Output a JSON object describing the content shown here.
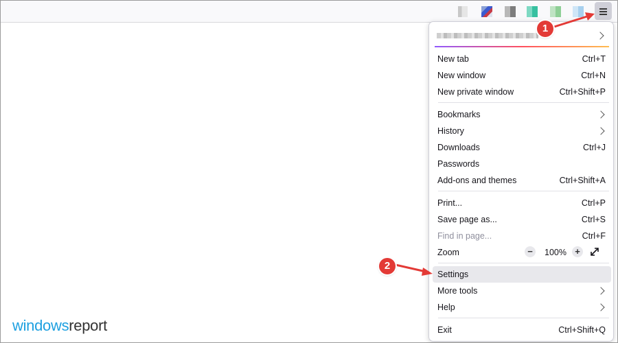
{
  "extensions": [
    {
      "icon": "extension-icon-1"
    },
    {
      "icon": "extension-icon-2"
    },
    {
      "icon": "extension-icon-3"
    },
    {
      "icon": "extension-icon-4"
    },
    {
      "icon": "extension-icon-5"
    },
    {
      "icon": "extension-icon-6"
    }
  ],
  "menu_button": {
    "icon": "hamburger-menu-icon"
  },
  "menu": {
    "new_tab": {
      "label": "New tab",
      "shortcut": "Ctrl+T"
    },
    "new_window": {
      "label": "New window",
      "shortcut": "Ctrl+N"
    },
    "new_private_window": {
      "label": "New private window",
      "shortcut": "Ctrl+Shift+P"
    },
    "bookmarks": {
      "label": "Bookmarks"
    },
    "history": {
      "label": "History"
    },
    "downloads": {
      "label": "Downloads",
      "shortcut": "Ctrl+J"
    },
    "passwords": {
      "label": "Passwords"
    },
    "addons": {
      "label": "Add-ons and themes",
      "shortcut": "Ctrl+Shift+A"
    },
    "print": {
      "label": "Print...",
      "shortcut": "Ctrl+P"
    },
    "save_page": {
      "label": "Save page as...",
      "shortcut": "Ctrl+S"
    },
    "find": {
      "label": "Find in page...",
      "shortcut": "Ctrl+F"
    },
    "zoom": {
      "label": "Zoom",
      "minus": "−",
      "value": "100%",
      "plus": "+"
    },
    "settings": {
      "label": "Settings"
    },
    "more_tools": {
      "label": "More tools"
    },
    "help": {
      "label": "Help"
    },
    "exit": {
      "label": "Exit",
      "shortcut": "Ctrl+Shift+Q"
    }
  },
  "annotations": {
    "step1": "1",
    "step2": "2",
    "color": "#e33a36"
  },
  "watermark": {
    "part1": "windows",
    "part2": "report"
  }
}
